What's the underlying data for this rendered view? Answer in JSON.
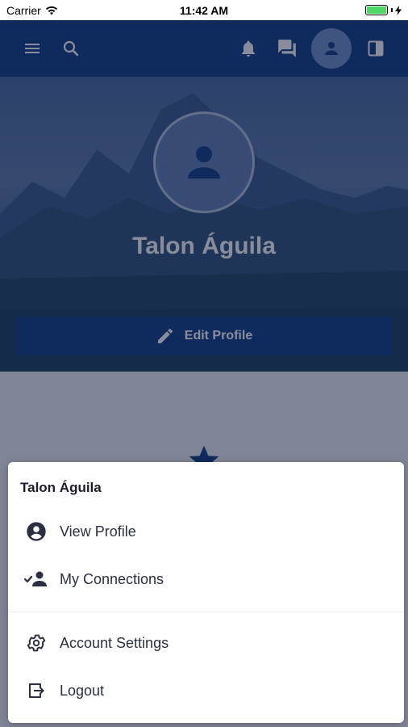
{
  "status_bar": {
    "carrier": "Carrier",
    "time": "11:42 AM"
  },
  "app_bar": {
    "icons": [
      "menu-icon",
      "search-icon",
      "bell-icon",
      "chat-icon",
      "avatar-icon",
      "panel-icon"
    ]
  },
  "profile": {
    "name": "Talon Águila",
    "edit_label": "Edit Profile"
  },
  "menu": {
    "title": "Talon Águila",
    "items": [
      {
        "label": "View Profile",
        "icon": "account-circle-icon"
      },
      {
        "label": "My Connections",
        "icon": "connections-icon"
      },
      {
        "label": "Account Settings",
        "icon": "gear-icon"
      },
      {
        "label": "Logout",
        "icon": "logout-icon"
      }
    ]
  },
  "colors": {
    "primary": "#0c3a80",
    "sheet_bg": "#ffffff",
    "menu_icon": "#2b2f42"
  }
}
